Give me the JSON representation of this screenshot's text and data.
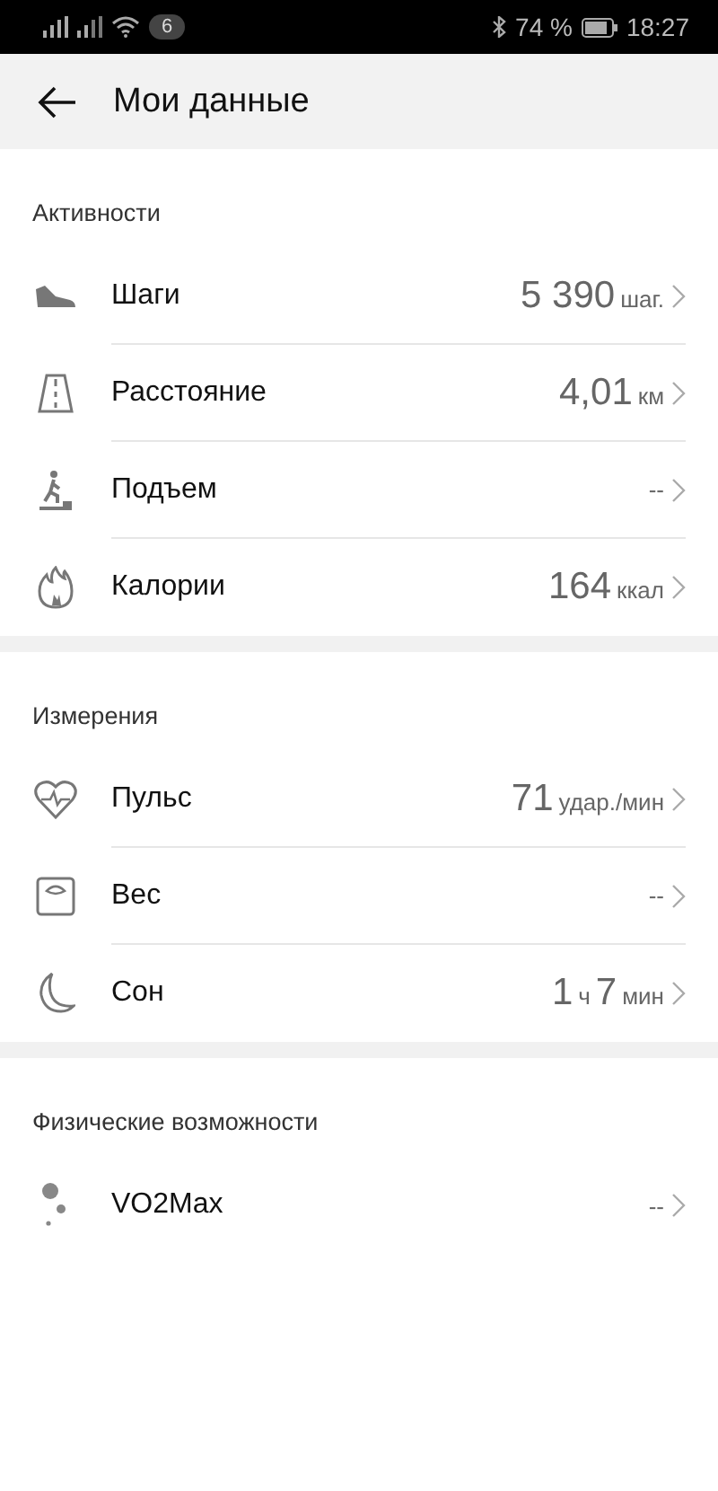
{
  "status_bar": {
    "notification_count": "6",
    "battery": "74 %",
    "time": "18:27"
  },
  "header": {
    "title": "Мои данные"
  },
  "sections": [
    {
      "title": "Активности",
      "items": [
        {
          "kind": "shoe",
          "label": "Шаги",
          "value": [
            {
              "kind": "number",
              "text": "5 390"
            },
            {
              "kind": "unit",
              "text": "шаг."
            }
          ]
        },
        {
          "kind": "road",
          "label": "Расстояние",
          "value": [
            {
              "kind": "number",
              "text": "4,01"
            },
            {
              "kind": "unit",
              "text": "км"
            }
          ]
        },
        {
          "kind": "climb",
          "label": "Подъем",
          "value": [
            {
              "kind": "unit",
              "text": "--"
            }
          ]
        },
        {
          "kind": "flame",
          "label": "Калории",
          "value": [
            {
              "kind": "number",
              "text": "164"
            },
            {
              "kind": "unit",
              "text": "ккал"
            }
          ]
        }
      ]
    },
    {
      "title": "Измерения",
      "items": [
        {
          "kind": "heart",
          "label": "Пульс",
          "value": [
            {
              "kind": "number",
              "text": "71"
            },
            {
              "kind": "unit",
              "text": "удар./мин"
            }
          ]
        },
        {
          "kind": "scale",
          "label": "Вес",
          "value": [
            {
              "kind": "unit",
              "text": "--"
            }
          ]
        },
        {
          "kind": "moon",
          "label": "Сон",
          "value": [
            {
              "kind": "number",
              "text": "1"
            },
            {
              "kind": "unit",
              "text": "ч"
            },
            {
              "kind": "number",
              "text": "7"
            },
            {
              "kind": "unit",
              "text": "мин"
            }
          ]
        }
      ]
    },
    {
      "title": "Физические возможности",
      "items": [
        {
          "kind": "dots",
          "label": "VO2Max",
          "value": [
            {
              "kind": "unit",
              "text": "--"
            }
          ]
        }
      ]
    }
  ]
}
